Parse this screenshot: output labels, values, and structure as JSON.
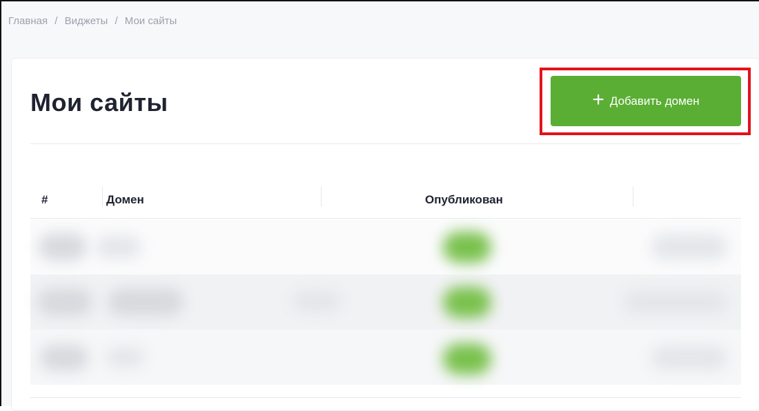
{
  "breadcrumb": {
    "items": [
      "Главная",
      "Виджеты",
      "Мои сайты"
    ],
    "separator": "/"
  },
  "page": {
    "title": "Мои сайты"
  },
  "toolbar": {
    "add_label": "Добавить домен",
    "add_icon": "plus-icon"
  },
  "table": {
    "columns": [
      "#",
      "Домен",
      "Опубликован"
    ],
    "rows_redacted": 3
  },
  "colors": {
    "accent": "#5aae34",
    "highlight": "#e3111a",
    "title": "#1f2330",
    "muted": "#9aa1ad"
  }
}
